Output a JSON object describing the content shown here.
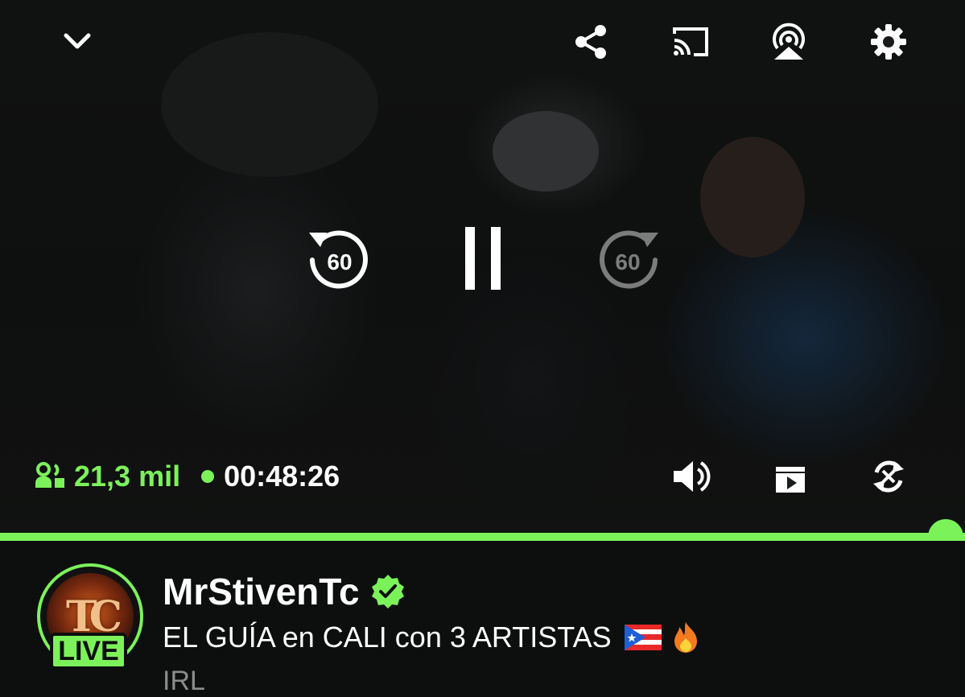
{
  "top_controls": {
    "collapse_icon": "chevron-down-icon",
    "share_icon": "share-icon",
    "cast_icon": "cast-icon",
    "airplay_icon": "airplay-icon",
    "settings_icon": "gear-icon"
  },
  "center_controls": {
    "rewind_label": "60",
    "forward_label": "60",
    "play_state_icon": "pause-icon"
  },
  "stats": {
    "viewers": "21,3 mil",
    "elapsed": "00:48:26"
  },
  "bottom_controls": {
    "volume_icon": "volume-icon",
    "theater_icon": "theater-mode-icon",
    "rotate_icon": "rotate-icon"
  },
  "progress": {
    "fraction": 0.98
  },
  "colors": {
    "accent": "#7cf25a",
    "background": "#0d0f0e"
  },
  "channel": {
    "name": "MrStivenTc",
    "live_badge": "LIVE",
    "stream_title": "EL GUÍA en CALI con 3 ARTISTAS",
    "category": "IRL"
  }
}
